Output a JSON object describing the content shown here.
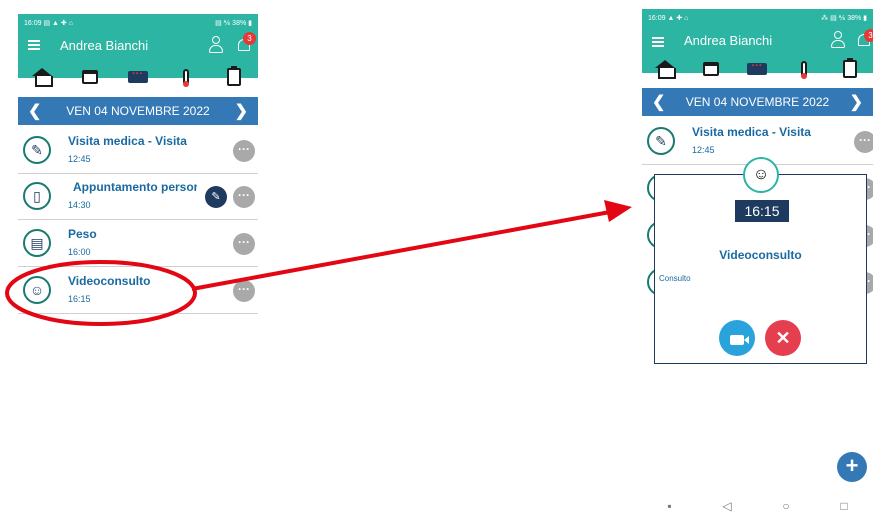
{
  "colors": {
    "teal": "#2db5a3",
    "blue": "#3478b6",
    "navy": "#1e3a5f",
    "title_blue": "#1a6aa1",
    "annotation_red": "#e30613"
  },
  "left_phone": {
    "status": {
      "time": "16:09",
      "icons": "▤ ▲ ✚ ⌂",
      "right": "▤ ⅍ 38% ▮"
    },
    "header": {
      "user_name": "Andrea Bianchi",
      "badge_count": "3"
    },
    "date_label": "VEN 04 NOVEMBRE 2022",
    "items": [
      {
        "title": "Visita medica - Visita",
        "time": "12:45",
        "icon": "pen-icon"
      },
      {
        "title": "Appuntamento persor",
        "time": "14:30",
        "icon": "phone-icon"
      },
      {
        "title": "Peso",
        "time": "16:00",
        "icon": "calendar-icon"
      },
      {
        "title": "Videoconsulto",
        "time": "16:15",
        "icon": "doctor-icon"
      }
    ]
  },
  "right_phone": {
    "status": {
      "time": "16:09",
      "icons": "▲ ✚ ⌂",
      "right": "⁂ ▤ ⅍ 38% ▮"
    },
    "header": {
      "user_name": "Andrea Bianchi",
      "badge_count": "3"
    },
    "date_label": "VEN 04 NOVEMBRE 2022",
    "items": [
      {
        "title": "Visita medica - Visita",
        "time": "12:45",
        "icon": "pen-icon"
      }
    ],
    "modal": {
      "time": "16:15",
      "title": "Videoconsulto",
      "description": "Consulto"
    }
  }
}
